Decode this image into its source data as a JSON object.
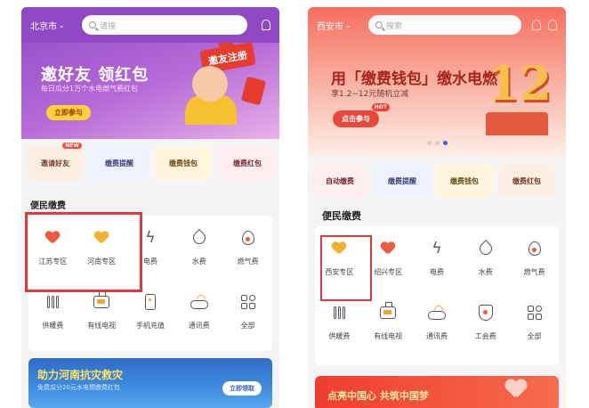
{
  "colors": {
    "purple_header": "#8f49c4",
    "highlight_red": "#e03a3a",
    "heart_red": "#ef5a3a",
    "heart_orange": "#f5b02e"
  },
  "left": {
    "city": "北京市",
    "search_placeholder": "请搜",
    "banner": {
      "title": "邀好友 领红包",
      "subtitle": "每日瓜分1万个水电燃气费红包",
      "button": "立即参与",
      "badge": "邀友注册"
    },
    "shortcuts": [
      {
        "label": "邀请好友",
        "tag": "NEW"
      },
      {
        "label": "缴费提醒"
      },
      {
        "label": "缴费钱包"
      },
      {
        "label": "缴费红包"
      }
    ],
    "section_title": "便民缴费",
    "services": [
      {
        "label": "江苏专区",
        "icon": "heart-icon"
      },
      {
        "label": "河南专区",
        "icon": "heart-icon"
      },
      {
        "label": "电费",
        "icon": "lightning-icon"
      },
      {
        "label": "水费",
        "icon": "water-drop-icon"
      },
      {
        "label": "燃气费",
        "icon": "flame-icon"
      },
      {
        "label": "供暖费",
        "icon": "radiator-icon"
      },
      {
        "label": "有线电视",
        "icon": "tv-icon"
      },
      {
        "label": "手机充值",
        "icon": "phone-icon"
      },
      {
        "label": "通讯费",
        "icon": "cloud-icon"
      },
      {
        "label": "全部",
        "icon": "all-grid-icon"
      }
    ],
    "bottom_banner": {
      "title": "助力河南抗灾救灾",
      "subtitle": "免费瓜分20元水电燃缴费红包",
      "button": "立即领取"
    }
  },
  "right": {
    "city": "西安市",
    "search_placeholder": "搜索",
    "banner": {
      "title": "用「缴费钱包」缴水电燃",
      "subtitle": "享1.2~12元随机立减",
      "button": "点击参与",
      "hot": "HOT",
      "big_number": "12"
    },
    "shortcuts": [
      {
        "label": "自动缴费"
      },
      {
        "label": "缴费提醒"
      },
      {
        "label": "缴费钱包"
      },
      {
        "label": "缴费红包"
      }
    ],
    "section_title": "便民缴费",
    "services": [
      {
        "label": "西安专区",
        "icon": "heart-icon"
      },
      {
        "label": "绍兴专区",
        "icon": "heart-icon"
      },
      {
        "label": "电费",
        "icon": "lightning-icon"
      },
      {
        "label": "水费",
        "icon": "water-drop-icon"
      },
      {
        "label": "燃气费",
        "icon": "flame-icon"
      },
      {
        "label": "供暖费",
        "icon": "radiator-icon"
      },
      {
        "label": "有线电视",
        "icon": "tv-icon"
      },
      {
        "label": "通讯费",
        "icon": "cloud-icon"
      },
      {
        "label": "工会费",
        "icon": "shield-icon"
      },
      {
        "label": "全部",
        "icon": "all-grid-icon"
      }
    ],
    "bottom_banner": {
      "title": "点亮中国心 共筑中国梦"
    }
  }
}
